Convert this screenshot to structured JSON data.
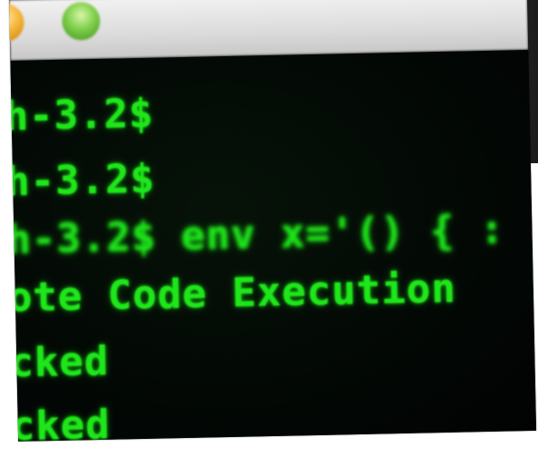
{
  "window": {
    "buttons": {
      "minimize_icon": "minimize-icon",
      "zoom_icon": "zoom-icon",
      "minimize_color": "#f6b63a",
      "zoom_color": "#7fcf4a"
    }
  },
  "terminal": {
    "text_color": "#1ee61a",
    "background": "#020703",
    "lines": [
      "h-3.2$",
      "h-3.2$",
      "h-3.2$ env x='() { :",
      "ote Code Execution",
      "cked",
      "cked"
    ]
  }
}
